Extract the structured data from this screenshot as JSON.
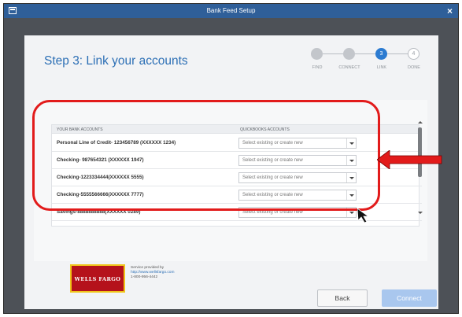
{
  "window": {
    "title": "Bank Feed Setup",
    "close_glyph": "×"
  },
  "step": {
    "title": "Step 3: Link your accounts"
  },
  "stepper": {
    "steps": [
      {
        "label": "FIND",
        "number": "",
        "state": "done"
      },
      {
        "label": "CONNECT",
        "number": "",
        "state": "done"
      },
      {
        "label": "LINK",
        "number": "3",
        "state": "current"
      },
      {
        "label": "DONE",
        "number": "4",
        "state": "todo"
      }
    ]
  },
  "table": {
    "headers": {
      "bank_accounts": "YOUR BANK ACCOUNTS",
      "qb_accounts": "QUICKBOOKS ACCOUNTS"
    },
    "rows": [
      {
        "account": "Personal Line of Credit- 123456789  (XXXXXX 1234)",
        "select_placeholder": "Select existing or create new"
      },
      {
        "account": "Checking- 987654321  (XXXXXX 1947)",
        "select_placeholder": "Select existing or create new"
      },
      {
        "account": "Checking-1223334444(XXXXXX 5555)",
        "select_placeholder": "Select existing or create new"
      },
      {
        "account": "Checking-5555566666(XXXXXX 7777)",
        "select_placeholder": "Select existing or create new"
      },
      {
        "account": "Savings-8888888888(XXXXXX 0289)",
        "select_placeholder": "Select existing or create new"
      }
    ]
  },
  "provider": {
    "logo_text": "WELLS FARGO",
    "service_text": "Service provided by",
    "url": "http://www.wellsfargo.com",
    "phone": "1-800-956-4442"
  },
  "buttons": {
    "back": "Back",
    "connect": "Connect"
  },
  "colors": {
    "titlebar": "#2f5f99",
    "accent": "#2c6fb5",
    "highlight": "#e21b1b",
    "connect_disabled": "#a9c7ee"
  }
}
